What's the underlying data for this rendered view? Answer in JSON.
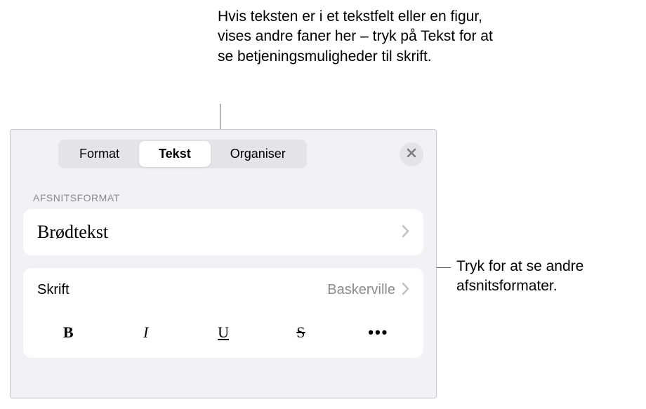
{
  "callouts": {
    "top": "Hvis teksten er i et tekstfelt eller en figur, vises andre faner her – tryk på Tekst for at se betjeningsmuligheder til skrift.",
    "right": "Tryk for at se andre afsnitsformater."
  },
  "tabs": {
    "format": "Format",
    "tekst": "Tekst",
    "organiser": "Organiser"
  },
  "section": {
    "paragraph_format_label": "AFSNITSFORMAT",
    "paragraph_style": "Brødtekst"
  },
  "font": {
    "label": "Skrift",
    "value": "Baskerville"
  },
  "style_buttons": {
    "bold": "B",
    "italic": "I",
    "underline": "U",
    "strike": "S",
    "more": "•••"
  }
}
